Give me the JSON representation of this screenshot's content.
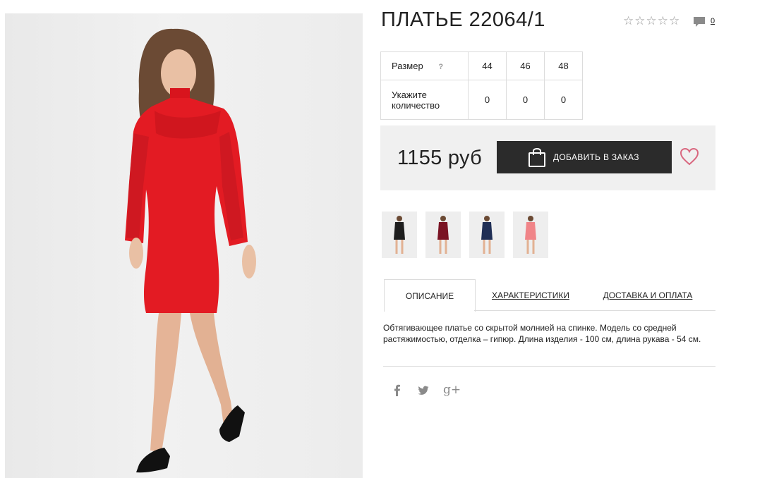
{
  "product": {
    "title": "ПЛАТЬЕ 22064/1",
    "rating_stars": 0,
    "rating_max": 5,
    "comments_count": "0"
  },
  "size_table": {
    "size_label": "Размер",
    "help_mark": "?",
    "sizes": [
      "44",
      "46",
      "48"
    ],
    "quantity_label_line1": "Укажите",
    "quantity_label_line2": "количество",
    "quantities": [
      "0",
      "0",
      "0"
    ]
  },
  "price": {
    "value": "1155 руб",
    "order_button_label": "ДОБАВИТЬ В ЗАКАЗ"
  },
  "colors": {
    "dress_red": "#e31b23",
    "thumb_black": "#1e1e1e",
    "thumb_burgundy": "#7a1424",
    "thumb_navy": "#1f2e55",
    "thumb_pink": "#f08488",
    "heart": "#d9677f",
    "button_bg": "#2b2b2b"
  },
  "icons": {
    "star": "star-outline-icon",
    "comment": "comment-bubble-icon",
    "bag": "shopping-bag-icon",
    "heart": "heart-outline-icon",
    "facebook": "facebook-icon",
    "twitter": "twitter-icon",
    "googleplus": "google-plus-icon"
  },
  "tabs": [
    {
      "label": "ОПИСАНИЕ",
      "active": true
    },
    {
      "label": "ХАРАКТЕРИСТИКИ",
      "active": false
    },
    {
      "label": "ДОСТАВКА И ОПЛАТА",
      "active": false
    }
  ],
  "description": "Обтягивающее платье со скрытой молнией на спинке. Модель со средней растяжимостью, отделка – гипюр. Длина изделия - 100 см, длина рукава - 54 см.",
  "social": {
    "facebook_glyph": "f",
    "googleplus_glyph": "g+"
  }
}
